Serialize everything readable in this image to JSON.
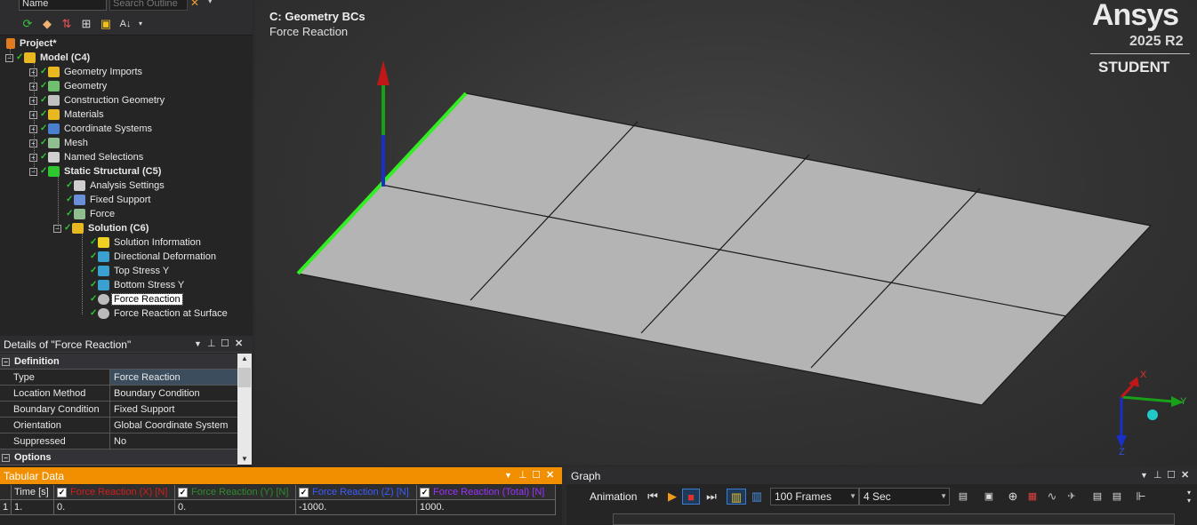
{
  "outline": {
    "name_combo": "Name",
    "search_placeholder": "Search Outline",
    "tree": [
      {
        "label": "Project*",
        "bold": true
      },
      {
        "label": "Model (C4)",
        "bold": true
      },
      {
        "label": "Geometry Imports"
      },
      {
        "label": "Geometry"
      },
      {
        "label": "Construction Geometry"
      },
      {
        "label": "Materials"
      },
      {
        "label": "Coordinate Systems"
      },
      {
        "label": "Mesh"
      },
      {
        "label": "Named Selections"
      },
      {
        "label": "Static Structural (C5)",
        "bold": true
      },
      {
        "label": "Analysis Settings"
      },
      {
        "label": "Fixed Support"
      },
      {
        "label": "Force"
      },
      {
        "label": "Solution (C6)",
        "bold": true
      },
      {
        "label": "Solution Information"
      },
      {
        "label": "Directional Deformation"
      },
      {
        "label": "Top Stress Y"
      },
      {
        "label": "Bottom Stress Y"
      },
      {
        "label": "Force Reaction",
        "selected": true
      },
      {
        "label": "Force Reaction at Surface"
      }
    ]
  },
  "details": {
    "title": "Details of \"Force Reaction\"",
    "sections": [
      {
        "name": "Definition",
        "rows": [
          {
            "name": "Type",
            "value": "Force Reaction"
          },
          {
            "name": "Location Method",
            "value": "Boundary Condition"
          },
          {
            "name": "Boundary Condition",
            "value": "Fixed Support"
          },
          {
            "name": "Orientation",
            "value": "Global Coordinate System"
          },
          {
            "name": "Suppressed",
            "value": "No"
          }
        ]
      },
      {
        "name": "Options",
        "rows": []
      }
    ]
  },
  "viewport": {
    "title": "C: Geometry BCs",
    "subtitle": "Force Reaction",
    "logo": {
      "brand": "Ansys",
      "version": "2025 R2",
      "edition": "STUDENT"
    },
    "triad": {
      "x": "X",
      "y": "Y",
      "z": "Z"
    },
    "colors": {
      "edge_highlight": "#33ee22",
      "mesh_face": "#b4b4b4",
      "x_axis": "#d01818",
      "y_axis": "#18a018",
      "z_axis": "#1830c8"
    }
  },
  "tabular": {
    "title": "Tabular Data",
    "columns": [
      {
        "label": "Time [s]",
        "color": "#e6e6e6",
        "checkbox": false
      },
      {
        "label": "Force Reaction (X) [N]",
        "color": "#d21e1e",
        "checkbox": true
      },
      {
        "label": "Force Reaction (Y) [N]",
        "color": "#2e8b2e",
        "checkbox": true
      },
      {
        "label": "Force Reaction (Z) [N]",
        "color": "#3a5cff",
        "checkbox": true
      },
      {
        "label": "Force Reaction (Total) [N]",
        "color": "#9b30ff",
        "checkbox": true
      }
    ],
    "rows": [
      {
        "index": "1",
        "cells": [
          "1.",
          "0.",
          "0.",
          "-1000.",
          "1000."
        ]
      }
    ]
  },
  "graph": {
    "title": "Graph",
    "animation_label": "Animation",
    "frames": "100 Frames",
    "duration": "4 Sec"
  }
}
